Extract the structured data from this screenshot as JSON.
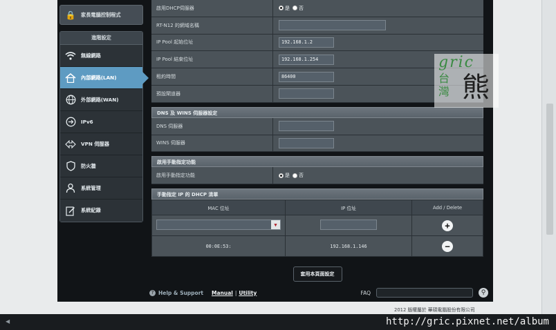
{
  "sidebar": {
    "parental_control": "家長電腦控制程式",
    "advanced_title": "進階設定",
    "items": [
      {
        "label": "無線網路",
        "icon": "wifi-icon"
      },
      {
        "label": "內部網路(LAN)",
        "icon": "home-icon",
        "active": true
      },
      {
        "label": "外部網路(WAN)",
        "icon": "globe-icon"
      },
      {
        "label": "IPv6",
        "icon": "ipv6-icon"
      },
      {
        "label": "VPN 伺服器",
        "icon": "vpn-icon"
      },
      {
        "label": "防火牆",
        "icon": "shield-icon"
      },
      {
        "label": "系統管理",
        "icon": "admin-icon"
      },
      {
        "label": "系統紀錄",
        "icon": "log-icon"
      }
    ]
  },
  "dhcp": {
    "enable_label": "啟用DHCP伺服器",
    "yes": "是",
    "no": "否",
    "domain_label": "RT-N12 的網域名稱",
    "domain_value": "",
    "pool_start_label": "IP Pool 起始位址",
    "pool_start_value": "192.168.1.2",
    "pool_end_label": "IP Pool 結束位址",
    "pool_end_value": "192.168.1.254",
    "lease_label": "租約時間",
    "lease_value": "86400",
    "gateway_label": "預設閘道器",
    "gateway_value": ""
  },
  "dns_section": {
    "title": "DNS 及 WINS 伺服器設定",
    "dns_label": "DNS 伺服器",
    "wins_label": "WINS 伺服器"
  },
  "manual_section": {
    "title": "啟用手動指定功能",
    "label": "啟用手動指定功能",
    "yes": "是",
    "no": "否"
  },
  "dhcp_list": {
    "title": "手動指定 IP 的 DHCP 清單",
    "col_mac": "MAC 位址",
    "col_ip": "IP 位址",
    "col_action": "Add / Delete",
    "entry_mac": "00:0E:53:",
    "entry_ip": "192.168.1.146"
  },
  "apply_label": "套用本頁面設定",
  "footer": {
    "help": "Help & Support",
    "manual": "Manual",
    "separator": "|",
    "utility": "Utility",
    "faq": "FAQ",
    "copyright": "2012 版權屬於 華碩電腦股份有限公司"
  },
  "watermark": {
    "gric": "gric",
    "tai": "台",
    "wan": "灣",
    "xiong": "熊",
    "url": "http://gric.pixnet.net/album"
  }
}
